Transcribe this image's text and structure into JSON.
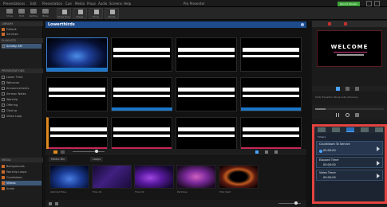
{
  "menubar": {
    "items": [
      "Presentations",
      "Edit",
      "Presentation",
      "Cue",
      "Media",
      "Props",
      "Audio",
      "Screens",
      "Help"
    ],
    "title": "Pro Presenter",
    "record_label": "Record Stream"
  },
  "toolbar": {
    "left_buttons": [
      "Show",
      "Edit",
      "Reflow",
      "Bible"
    ],
    "center_buttons": [
      "Show Directory",
      "Stage",
      "Timer",
      "Media"
    ]
  },
  "library": {
    "library_header": "LIBRARY",
    "library_items": [
      "Default",
      "Services"
    ],
    "playlist_header": "PLAYLISTS",
    "playlist_items": [
      "Sunday AM"
    ],
    "presentations_header": "PRESENTATIONS",
    "presentation_items": [
      "Lower Third",
      "Welcome",
      "Announcements",
      "Sermon Notes",
      "Worship",
      "Offering",
      "Closing",
      "Video Loop"
    ]
  },
  "media_bin": {
    "header": "MEDIA",
    "items": [
      "Backgrounds",
      "Worship Loops",
      "Countdown",
      "Videos",
      "Audio"
    ],
    "selected_index": 3
  },
  "main": {
    "title": "Lowerthirds"
  },
  "bin": {
    "tabs": [
      "Media Bin",
      "Loops"
    ],
    "thumbs": [
      "Abstract Blue",
      "Flow 01",
      "Flow 02",
      "Particles",
      "Pink Swirl"
    ]
  },
  "right": {
    "preview_text": "WELCOME",
    "status_line": "Slide Transition  None  Auto Advance",
    "progress_pct": 15
  },
  "timers": {
    "section": "Timers",
    "rows": [
      {
        "label": "Countdown To Service",
        "time": "00:00:00"
      },
      {
        "label": "Elapsed Timer",
        "time": "00:00:00"
      },
      {
        "label": "Video Timer",
        "time": "00:00:00"
      }
    ]
  },
  "colors": {
    "accent": "#1d4b8c",
    "highlight": "#e4433f",
    "bar_blue": "#1e78c8",
    "bar_pink": "#c8285a"
  }
}
